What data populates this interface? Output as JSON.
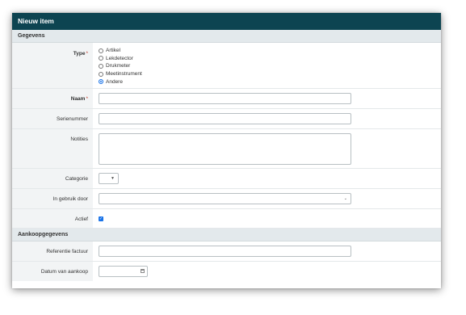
{
  "window": {
    "title": "Nieuw item"
  },
  "sections": {
    "gegevens": "Gegevens",
    "aankoop": "Aankoopgegevens"
  },
  "fields": {
    "type": {
      "label": "Type",
      "required": "*",
      "options": [
        "Artikel",
        "Lekdetector",
        "Drukmeter",
        "Meetinstrument",
        "Andere"
      ],
      "selected": "Andere"
    },
    "naam": {
      "label": "Naam",
      "required": "*",
      "value": ""
    },
    "serienummer": {
      "label": "Serienummer",
      "value": ""
    },
    "notities": {
      "label": "Notities",
      "value": ""
    },
    "categorie": {
      "label": "Categorie",
      "value": ""
    },
    "in_gebruik_door": {
      "label": "In gebruik door",
      "value": ""
    },
    "actief": {
      "label": "Actief",
      "checked": true
    },
    "referentie_factuur": {
      "label": "Referentie factuur",
      "value": ""
    },
    "datum_van_aankoop": {
      "label": "Datum van aankoop",
      "value": ""
    }
  },
  "icons": {
    "select_arrow": "chevron-down-icon",
    "calendar": "calendar-icon",
    "check": "checkmark-icon"
  },
  "colors": {
    "titlebar": "#0d4451",
    "section": "#e3e9ec",
    "label_bg": "#f2f4f5",
    "accent": "#1a73e8",
    "required": "#c0392b"
  }
}
